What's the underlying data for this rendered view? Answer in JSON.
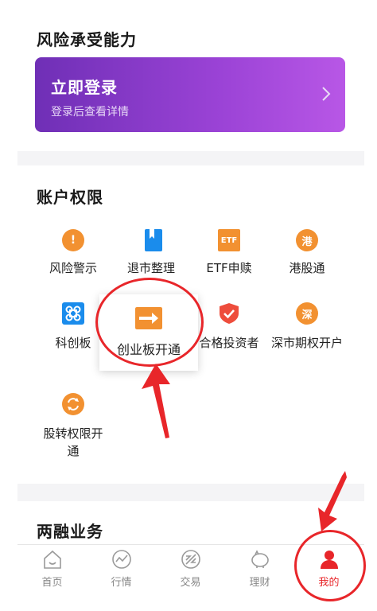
{
  "risk_section": {
    "title": "风险承受能力",
    "login_title": "立即登录",
    "login_subtitle": "登录后查看详情"
  },
  "permissions_section": {
    "title": "账户权限",
    "items": [
      {
        "label": "风险警示",
        "icon": "warning-icon"
      },
      {
        "label": "退市整理",
        "icon": "bookmark-icon"
      },
      {
        "label": "ETF申赎",
        "icon": "etf-icon",
        "icon_text": "ETF"
      },
      {
        "label": "港股通",
        "icon": "hk-connect-icon",
        "icon_text": "港"
      },
      {
        "label": "科创板",
        "icon": "star-market-icon"
      },
      {
        "label": "创业板开通",
        "icon": "gem-arrow-icon"
      },
      {
        "label": "合格投资者",
        "icon": "shield-check-icon"
      },
      {
        "label": "深市期权开户",
        "icon": "sz-options-icon",
        "icon_text": "深"
      },
      {
        "label": "股转权限开通",
        "icon": "neeq-icon"
      }
    ]
  },
  "margin_section": {
    "title": "两融业务"
  },
  "tabbar": {
    "tabs": [
      {
        "label": "首页",
        "icon": "home-icon"
      },
      {
        "label": "行情",
        "icon": "market-chart-icon"
      },
      {
        "label": "交易",
        "icon": "trade-icon"
      },
      {
        "label": "理财",
        "icon": "piggy-bank-icon"
      },
      {
        "label": "我的",
        "icon": "user-icon",
        "active": true
      }
    ]
  },
  "colors": {
    "accent_orange": "#f29131",
    "active_red": "#e8262a",
    "banner_purple": "#8a3bc9",
    "bookmark_blue": "#1a8cec"
  }
}
